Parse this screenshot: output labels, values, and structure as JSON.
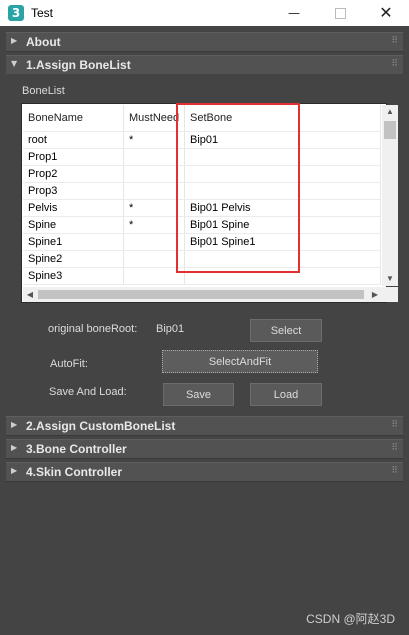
{
  "window": {
    "icon_glyph": "3",
    "title": "Test",
    "minimize": "—",
    "close": "✕"
  },
  "rollouts": {
    "about": {
      "arrow": "▶",
      "title": "About"
    },
    "assign_bonelist": {
      "arrow": "▼",
      "title": "1.Assign BoneList"
    },
    "assign_custom": {
      "arrow": "▶",
      "title": "2.Assign CustomBoneList"
    },
    "bone_controller": {
      "arrow": "▶",
      "title": "3.Bone Controller"
    },
    "skin_controller": {
      "arrow": "▶",
      "title": "4.Skin Controller"
    },
    "grip": "⠿"
  },
  "bonelist": {
    "group_label": "BoneList",
    "columns": [
      "BoneName",
      "MustNeed",
      "SetBone"
    ],
    "rows": [
      [
        "root",
        "*",
        "Bip01"
      ],
      [
        "Prop1",
        "",
        ""
      ],
      [
        "Prop2",
        "",
        ""
      ],
      [
        "Prop3",
        "",
        ""
      ],
      [
        "Pelvis",
        "*",
        "Bip01 Pelvis"
      ],
      [
        "Spine",
        "*",
        "Bip01 Spine"
      ],
      [
        "Spine1",
        "",
        "Bip01 Spine1"
      ],
      [
        "Spine2",
        "",
        ""
      ],
      [
        "Spine3",
        "",
        ""
      ]
    ],
    "scroll_up": "▲",
    "scroll_down": "▼",
    "scroll_left": "◀",
    "scroll_right": "▶"
  },
  "bone_root": {
    "label": "original boneRoot:",
    "value": "Bip01",
    "select_button": "Select"
  },
  "autofit": {
    "label": "AutoFit:",
    "button": "SelectAndFit"
  },
  "save_load": {
    "label": "Save And Load:",
    "save_button": "Save",
    "load_button": "Load"
  },
  "watermark": "CSDN @阿赵3D",
  "colors": {
    "highlight_box": "#e03030",
    "background": "#444444"
  }
}
